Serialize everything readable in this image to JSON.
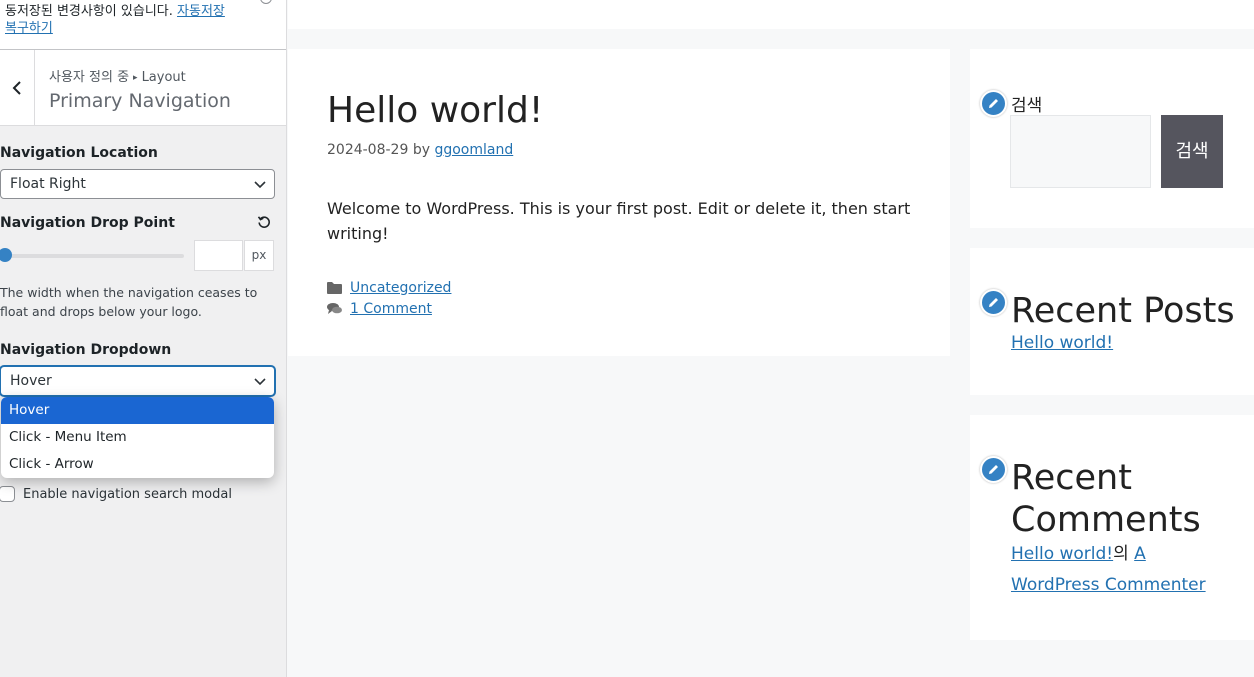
{
  "sidebar": {
    "notice": {
      "text": "동저장된 변경사항이 있습니다.",
      "link_line1": "자동저장",
      "link_line2": "복구하기"
    },
    "breadcrumb": {
      "parent": "사용자 정의 중",
      "separator": "▸",
      "child": "Layout"
    },
    "section_title": "Primary Navigation",
    "nav_location": {
      "label": "Navigation Location",
      "value": "Float Right"
    },
    "drop_point": {
      "label": "Navigation Drop Point",
      "value": "",
      "unit": "px",
      "slider_fraction": 0,
      "description": "The width when the navigation ceases to float and drops below your logo."
    },
    "nav_dropdown": {
      "label": "Navigation Dropdown",
      "value": "Hover",
      "options": [
        "Hover",
        "Click - Menu Item",
        "Click - Arrow"
      ]
    },
    "search_modal": {
      "label": "Enable navigation search modal",
      "checked": false
    }
  },
  "preview": {
    "post": {
      "title": "Hello world!",
      "date": "2024-08-29",
      "by": "by",
      "author": "ggoomland",
      "body": "Welcome to WordPress. This is your first post. Edit or delete it, then start writing!",
      "category": "Uncategorized",
      "comments": "1 Comment"
    },
    "widgets": {
      "search": {
        "title": "검색",
        "button_line1": "검",
        "button_line2": "색"
      },
      "recent_posts": {
        "title": "Recent Posts",
        "items": [
          "Hello world!"
        ]
      },
      "recent_comments": {
        "title_line1": "Recent",
        "title_line2": "Comments",
        "post_link": "Hello world!",
        "connector": "의",
        "author_line1": "A",
        "author_line2": "WordPress Commenter"
      }
    }
  },
  "colors": {
    "accent": "#2271b1",
    "selected_option": "#1a66d2",
    "search_button": "#55555e",
    "edit_icon": "#3582c4"
  }
}
